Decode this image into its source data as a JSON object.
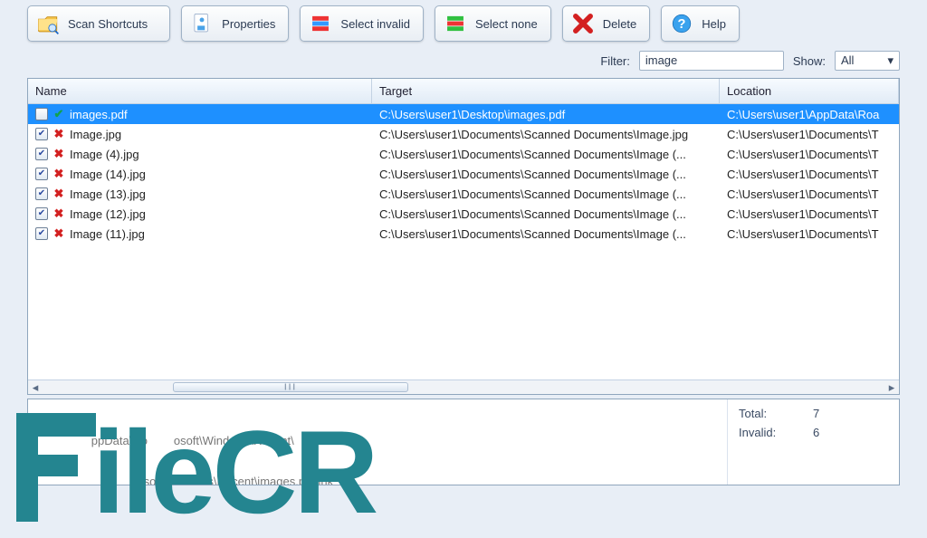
{
  "toolbar": {
    "scan": "Scan Shortcuts",
    "properties": "Properties",
    "select_invalid": "Select invalid",
    "select_none": "Select none",
    "delete": "Delete",
    "help": "Help"
  },
  "filter": {
    "label": "Filter:",
    "value": "image",
    "show_label": "Show:",
    "show_value": "All"
  },
  "columns": {
    "name": "Name",
    "target": "Target",
    "location": "Location"
  },
  "rows": [
    {
      "checked": false,
      "valid": true,
      "name": "images.pdf",
      "target": "C:\\Users\\user1\\Desktop\\images.pdf",
      "location": "C:\\Users\\user1\\AppData\\Roa",
      "selected": true
    },
    {
      "checked": true,
      "valid": false,
      "name": "Image.jpg",
      "target": "C:\\Users\\user1\\Documents\\Scanned Documents\\Image.jpg",
      "location": "C:\\Users\\user1\\Documents\\T"
    },
    {
      "checked": true,
      "valid": false,
      "name": "Image (4).jpg",
      "target": "C:\\Users\\user1\\Documents\\Scanned Documents\\Image (...",
      "location": "C:\\Users\\user1\\Documents\\T"
    },
    {
      "checked": true,
      "valid": false,
      "name": "Image (14).jpg",
      "target": "C:\\Users\\user1\\Documents\\Scanned Documents\\Image (...",
      "location": "C:\\Users\\user1\\Documents\\T"
    },
    {
      "checked": true,
      "valid": false,
      "name": "Image (13).jpg",
      "target": "C:\\Users\\user1\\Documents\\Scanned Documents\\Image (...",
      "location": "C:\\Users\\user1\\Documents\\T"
    },
    {
      "checked": true,
      "valid": false,
      "name": "Image (12).jpg",
      "target": "C:\\Users\\user1\\Documents\\Scanned Documents\\Image (...",
      "location": "C:\\Users\\user1\\Documents\\T"
    },
    {
      "checked": true,
      "valid": false,
      "name": "Image (11).jpg",
      "target": "C:\\Users\\user1\\Documents\\Scanned Documents\\Image (...",
      "location": "C:\\Users\\user1\\Documents\\T"
    }
  ],
  "details": {
    "line1": "                ppData\\Ro        osoft\\Windows\\Recent\\",
    "line2": "                              osoft\\Windows\\Recent\\images.pdf.lnk",
    "line3": "                    pdf"
  },
  "stats": {
    "total_label": "Total:",
    "total_value": "7",
    "invalid_label": "Invalid:",
    "invalid_value": "6"
  },
  "watermark": "ileCR"
}
